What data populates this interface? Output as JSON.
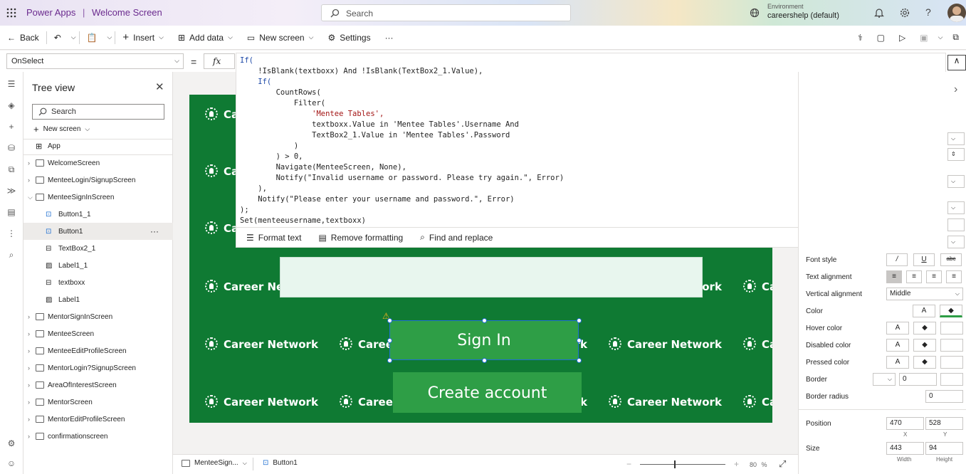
{
  "header": {
    "app_name": "Power Apps",
    "separator": "|",
    "screen_name": "Welcome Screen",
    "search_placeholder": "Search",
    "environment_label": "Environment",
    "environment_value": "careershelp (default)"
  },
  "toolbar": {
    "back": "Back",
    "insert": "Insert",
    "add_data": "Add data",
    "new_screen": "New screen",
    "settings": "Settings",
    "more": "···"
  },
  "formula_bar": {
    "property": "OnSelect",
    "equals": "=",
    "fx": "fx",
    "lines": [
      "If(",
      "    !IsBlank(textboxx) And !IsBlank(TextBox2_1.Value),",
      "    If(",
      "        CountRows(",
      "            Filter(",
      "                'Mentee Tables',",
      "                textboxx.Value in 'Mentee Tables'.Username And",
      "                TextBox2_1.Value in 'Mentee Tables'.Password",
      "            )",
      "        ) > 0,",
      "        Navigate(MenteeScreen, None),",
      "        Notify(\"Invalid username or password. Please try again.\", Error)",
      "    ),",
      "    Notify(\"Please enter your username and password.\", Error)",
      ");",
      "Set(menteeusername,textboxx)"
    ],
    "format_text": "Format text",
    "remove_formatting": "Remove formatting",
    "find_replace": "Find and replace"
  },
  "tree": {
    "title": "Tree view",
    "search_placeholder": "Search",
    "new_screen": "New screen",
    "items": [
      {
        "label": "App",
        "level": 0
      },
      {
        "label": "WelcomeScreen",
        "level": 0
      },
      {
        "label": "MenteeLogin/SignupScreen",
        "level": 0
      },
      {
        "label": "MenteeSignInScreen",
        "level": 0
      },
      {
        "label": "Button1_1",
        "level": 1
      },
      {
        "label": "Button1",
        "level": 1
      },
      {
        "label": "TextBox2_1",
        "level": 1
      },
      {
        "label": "Label1_1",
        "level": 1
      },
      {
        "label": "textboxx",
        "level": 1
      },
      {
        "label": "Label1",
        "level": 1
      },
      {
        "label": "MentorSignInScreen",
        "level": 0
      },
      {
        "label": "MenteeScreen",
        "level": 0
      },
      {
        "label": "MenteeEditProfileScreen",
        "level": 0
      },
      {
        "label": "MentorLogin?SignupScreen",
        "level": 0
      },
      {
        "label": "AreaOfInterestScreen",
        "level": 0
      },
      {
        "label": "MentorScreen",
        "level": 0
      },
      {
        "label": "MentorEditProfileScreen",
        "level": 0
      },
      {
        "label": "confirmationscreen",
        "level": 0
      }
    ],
    "selected": "Button1",
    "more": "···"
  },
  "canvas": {
    "watermark": "Career Network",
    "sign_in": "Sign In",
    "create_account": "Create account"
  },
  "properties": {
    "font_style": "Font style",
    "text_alignment": "Text alignment",
    "vertical_alignment": "Vertical alignment",
    "vertical_value": "Middle",
    "color": "Color",
    "hover_color": "Hover color",
    "disabled_color": "Disabled color",
    "pressed_color": "Pressed color",
    "border": "Border",
    "border_value": "0",
    "border_radius": "Border radius",
    "border_radius_value": "0",
    "position": "Position",
    "pos_x": "470",
    "pos_y": "528",
    "x_label": "X",
    "y_label": "Y",
    "size": "Size",
    "width": "443",
    "height": "94",
    "width_label": "Width",
    "height_label": "Height",
    "letter_a": "A",
    "italic": "/",
    "underline": "U",
    "strike": "abc"
  },
  "bottom": {
    "screen_tab": "MenteeSign...",
    "control_tab": "Button1",
    "zoom": "80",
    "percent": "%"
  }
}
